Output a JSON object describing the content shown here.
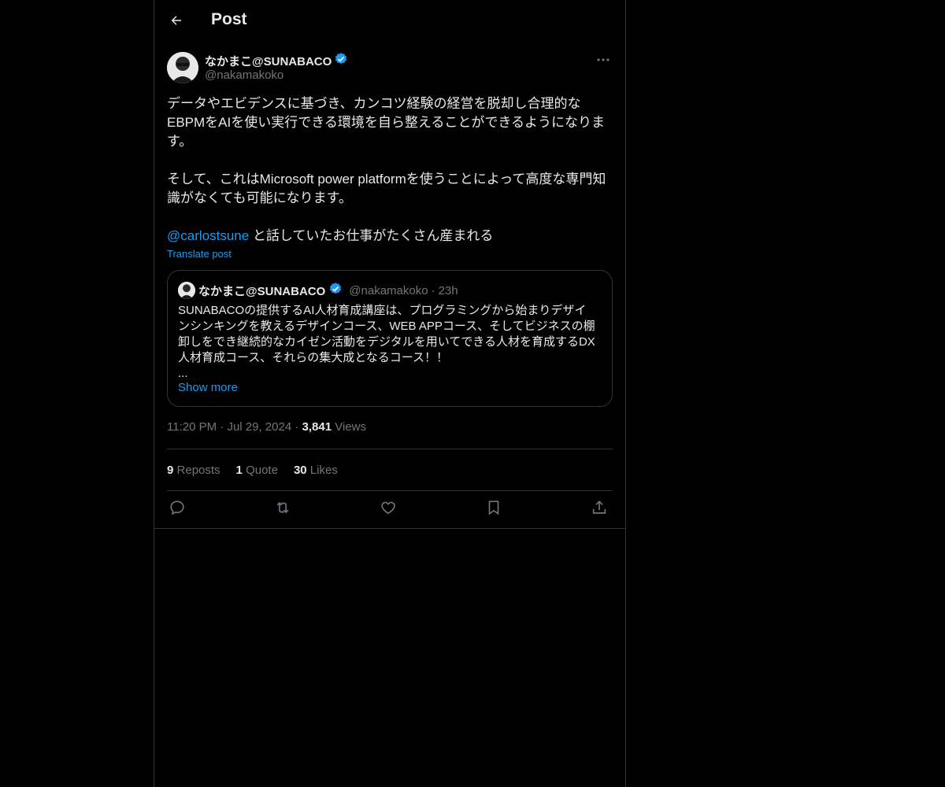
{
  "header": {
    "title": "Post"
  },
  "post": {
    "author_name": "なかまこ@SUNABACO",
    "author_handle": "@nakamakoko",
    "text_para1": "データやエビデンスに基づき、カンコツ経験の経営を脱却し合理的なEBPMをAIを使い実行できる環境を自ら整えることができるようになります。",
    "text_para2": "そして、これはMicrosoft power platformを使うことによって高度な専門知識がなくても可能になります。",
    "mention": "@carlostsune",
    "text_para3": " と話していたお仕事がたくさん産まれる",
    "translate": "Translate post",
    "time": "11:20 PM",
    "date": "Jul 29, 2024",
    "views_count": "3,841",
    "views_label": "Views",
    "reposts_count": "9",
    "reposts_label": "Reposts",
    "quotes_count": "1",
    "quotes_label": "Quote",
    "likes_count": "30",
    "likes_label": "Likes"
  },
  "quote": {
    "author_name": "なかまこ@SUNABACO",
    "author_handle": "@nakamakoko",
    "time": "23h",
    "text": "SUNABACOの提供するAI人材育成講座は、プログラミングから始まりデザインシンキングを教えるデザインコース、WEB APPコース、そしてビジネスの棚卸しをでき継続的なカイゼン活動をデジタルを用いてできる人材を育成するDX人材育成コース、それらの集大成となるコース！！\n...",
    "show_more": "Show more"
  },
  "icons": [
    "back-arrow-icon",
    "verified-badge-icon",
    "more-icon",
    "reply-icon",
    "repost-icon",
    "like-icon",
    "bookmark-icon",
    "share-icon"
  ],
  "colors": {
    "accent": "#1d9bf0",
    "background": "#000000",
    "text": "#e7e9ea",
    "muted": "#71767b",
    "border": "#2f3336"
  }
}
